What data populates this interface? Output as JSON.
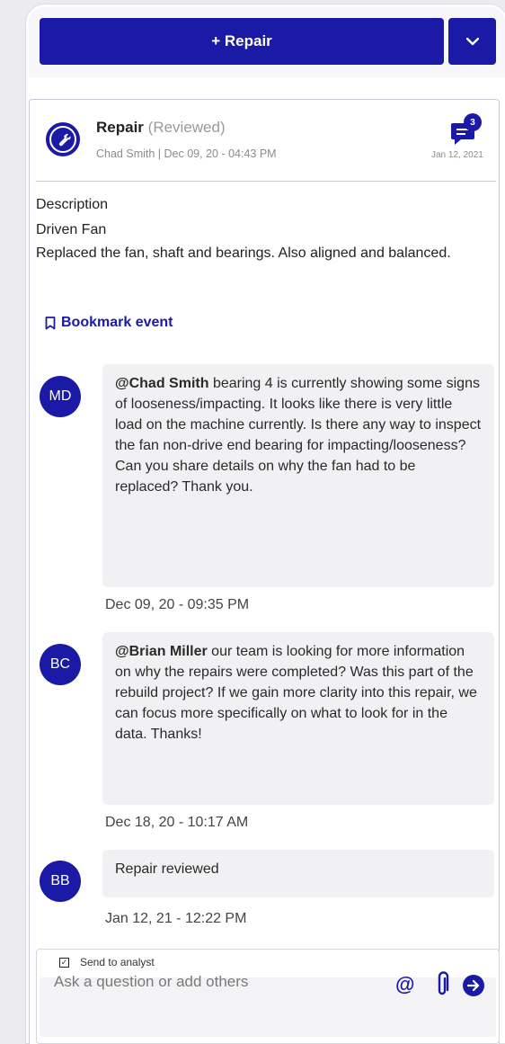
{
  "toolbar": {
    "add_button_label": "+ Repair",
    "dropdown_icon": "chevron-down-icon"
  },
  "event": {
    "icon": "wrench-icon",
    "type": "Repair",
    "status": "(Reviewed)",
    "meta": "Chad Smith | Dec 09, 20 - 04:43 PM",
    "comment_count": "3",
    "comment_icon": "comment-icon",
    "last_activity_date": "Jan 12, 2021",
    "description_heading": "Description",
    "description_lines": [
      "Driven Fan",
      "Replaced the fan, shaft and bearings. Also aligned and balanced."
    ],
    "bookmark_label": "Bookmark event",
    "accent_color": "#1a1aa6"
  },
  "comments": [
    {
      "initials": "MD",
      "mention": "@Chad Smith",
      "text": " bearing 4 is currently showing some signs of looseness/impacting. It looks like there is very little load on the machine currently. Is there any way to inspect the fan non-drive end bearing for impacting/looseness? Can you share details on why the fan had to be replaced?  Thank you.",
      "timestamp": "Dec 09, 20 - 09:35 PM"
    },
    {
      "initials": "BC",
      "mention": "@Brian Miller",
      "text": " our team is looking for more information on why the repairs were completed? Was this part of the rebuild project? If we gain more clarity into this repair, we can focus more specifically on what to look for in the data. Thanks!",
      "timestamp": "Dec 18, 20 - 10:17 AM"
    },
    {
      "initials": "BB",
      "mention": "",
      "text": "Repair reviewed",
      "timestamp": "Jan 12, 21 - 12:22 PM"
    }
  ],
  "composer": {
    "send_to_analyst_label": "Send to analyst",
    "send_to_analyst_checked": true,
    "placeholder": "Ask a question or add others",
    "mention_icon": "at-icon",
    "attach_icon": "paperclip-icon",
    "send_icon": "send-arrow-icon"
  }
}
